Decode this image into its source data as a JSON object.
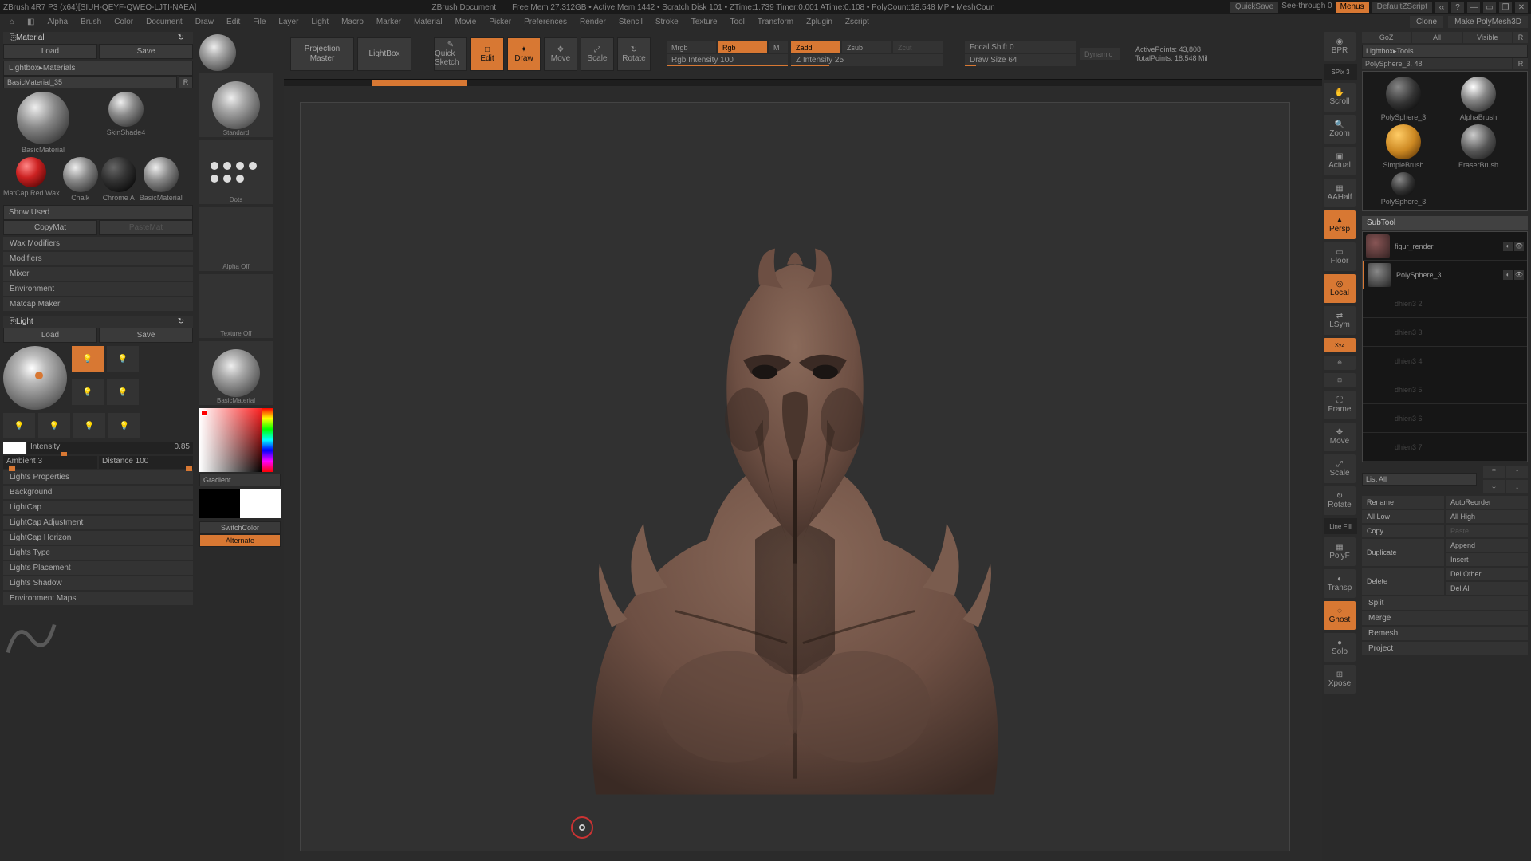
{
  "titlebar": {
    "app": "ZBrush 4R7 P3 (x64)[SIUH-QEYF-QWEO-LJTI-NAEA]",
    "doc": "ZBrush Document",
    "stats": "Free Mem 27.312GB  •  Active Mem 1442  •  Scratch Disk 101  •  ZTime:1.739 Timer:0.001 ATime:0.108  •  PolyCount:18.548 MP  •  MeshCoun",
    "quicksave": "QuickSave",
    "seethrough": "See-through  0",
    "menus": "Menus",
    "script": "DefaultZScript"
  },
  "menu": [
    "Alpha",
    "Brush",
    "Color",
    "Document",
    "Draw",
    "Edit",
    "File",
    "Layer",
    "Light",
    "Macro",
    "Marker",
    "Material",
    "Movie",
    "Picker",
    "Preferences",
    "Render",
    "Stencil",
    "Stroke",
    "Texture",
    "Tool",
    "Transform",
    "Zplugin",
    "Zscript"
  ],
  "menuRight": {
    "clone": "Clone",
    "mpm": "Make PolyMesh3D"
  },
  "material": {
    "title": "Material",
    "load": "Load",
    "save": "Save",
    "lightbox": "Lightbox▸Materials",
    "current": "BasicMaterial_35",
    "swatches": [
      {
        "name": "BasicMaterial"
      },
      {
        "name": "SkinShade4"
      },
      {
        "name": "MatCap Red Wax"
      },
      {
        "name": "Chalk"
      },
      {
        "name": "Chrome A"
      },
      {
        "name": "BasicMaterial"
      }
    ],
    "showUsed": "Show Used",
    "copy": "CopyMat",
    "paste": "PasteMat",
    "sections": [
      "Wax Modifiers",
      "Modifiers",
      "Mixer",
      "Environment",
      "Matcap Maker"
    ]
  },
  "light": {
    "title": "Light",
    "load": "Load",
    "save": "Save",
    "intensityLabel": "Intensity",
    "intensity": "0.85",
    "ambient": "Ambient 3",
    "distance": "Distance 100",
    "sections": [
      "Lights Properties",
      "Background",
      "LightCap",
      "LightCap Adjustment",
      "LightCap Horizon",
      "Lights Type",
      "Lights Placement",
      "Lights Shadow",
      "Environment Maps"
    ]
  },
  "shelf": {
    "projection": "Projection Master",
    "lightbox": "LightBox",
    "quickSketch": "Quick Sketch",
    "edit": "Edit",
    "draw": "Draw",
    "move": "Move",
    "scale": "Scale",
    "rotate": "Rotate",
    "mrgb": "Mrgb",
    "rgb": "Rgb",
    "m": "M",
    "rgbInt": "Rgb Intensity 100",
    "zadd": "Zadd",
    "zsub": "Zsub",
    "zcut": "Zcut",
    "zInt": "Z Intensity 25",
    "focal": "Focal Shift 0",
    "drawSize": "Draw Size 64",
    "dynamic": "Dynamic",
    "activePoints": "ActivePoints: 43,808",
    "totalPoints": "TotalPoints: 18.548 Mil"
  },
  "brushCol": {
    "standard": "Standard",
    "dots": "Dots",
    "alphaOff": "Alpha Off",
    "textureOff": "Texture Off",
    "basicMat": "BasicMaterial",
    "gradient": "Gradient",
    "switchColor": "SwitchColor",
    "alternate": "Alternate"
  },
  "nav": {
    "bpr": "BPR",
    "spix": "SPix 3",
    "scroll": "Scroll",
    "zoom": "Zoom",
    "actual": "Actual",
    "aahalf": "AAHalf",
    "persp": "Persp",
    "floor": "Floor",
    "local": "Local",
    "lsym": "LSym",
    "xyz": "Xyz",
    "frame": "Frame",
    "move": "Move",
    "scale": "Scale",
    "rotate": "Rotate",
    "linefill": "Line Fill",
    "polyf": "PolyF",
    "transp": "Transp",
    "ghost": "Ghost",
    "solo": "Solo",
    "xpose": "Xpose"
  },
  "right": {
    "goz": "GoZ",
    "all": "All",
    "visible": "Visible",
    "r": "R",
    "lightboxTools": "Lightbox▸Tools",
    "currentTool": "PolySphere_3. 48",
    "brushes": [
      "PolySphere_3",
      "AlphaBrush",
      "SimpleBrush",
      "EraserBrush",
      "PolySphere_3"
    ],
    "subtool": "SubTool",
    "items": [
      {
        "name": "figur_render",
        "ghost": false,
        "active": false
      },
      {
        "name": "PolySphere_3",
        "ghost": false,
        "active": true
      },
      {
        "name": "dhien3 2",
        "ghost": true
      },
      {
        "name": "dhien3 3",
        "ghost": true
      },
      {
        "name": "dhien3 4",
        "ghost": true
      },
      {
        "name": "dhien3 5",
        "ghost": true
      },
      {
        "name": "dhien3 6",
        "ghost": true
      },
      {
        "name": "dhien3 7",
        "ghost": true
      }
    ],
    "listAll": "List All",
    "ops": {
      "rename": "Rename",
      "autoReorder": "AutoReorder",
      "allLow": "All Low",
      "allHigh": "All High",
      "copy": "Copy",
      "paste": "Paste",
      "duplicate": "Duplicate",
      "append": "Append",
      "insert": "Insert",
      "delete": "Delete",
      "delOther": "Del Other",
      "delAll": "Del All",
      "split": "Split",
      "merge": "Merge",
      "remesh": "Remesh",
      "project": "Project"
    }
  }
}
